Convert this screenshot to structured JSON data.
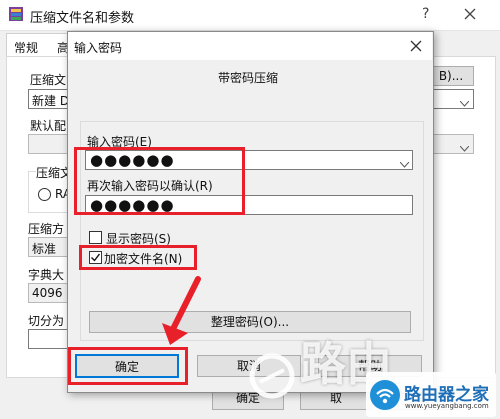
{
  "back_window": {
    "title": "压缩文件名和参数",
    "tab_general": "常规",
    "tab_advanced_partial": "高",
    "archive_name_label": "压缩文",
    "archive_name_value": "新建 D",
    "browse_label": "B)...",
    "default_profile_label": "默认配",
    "archive_format_label": "压缩文",
    "radio_rar_label": "RA",
    "method_label": "压缩方",
    "method_value": "标准",
    "dict_label": "字典大",
    "dict_value": "4096 K",
    "split_label": "切分为",
    "ok_label": "确定",
    "cancel_partial": "取",
    "help_partial": "助"
  },
  "dialog": {
    "title": "输入密码",
    "heading": "带密码压缩",
    "password_label": "输入密码(E)",
    "password_value": "●●●●●●",
    "confirm_label": "再次输入密码以确认(R)",
    "confirm_value": "●●●●●●",
    "show_password_label": "显示密码(S)",
    "encrypt_names_label": "加密文件名(N)",
    "organize_label": "整理密码(O)...",
    "ok_label": "确定",
    "cancel_label": "取消",
    "help_label": "帮助",
    "show_password_checked": false,
    "encrypt_names_checked": true
  },
  "watermark": {
    "text_large": "路由",
    "site_name": "路由器之家",
    "url": "www.yueyangbang.com"
  },
  "colors": {
    "highlight_red": "#e8202a",
    "focus_blue": "#0078d7"
  }
}
